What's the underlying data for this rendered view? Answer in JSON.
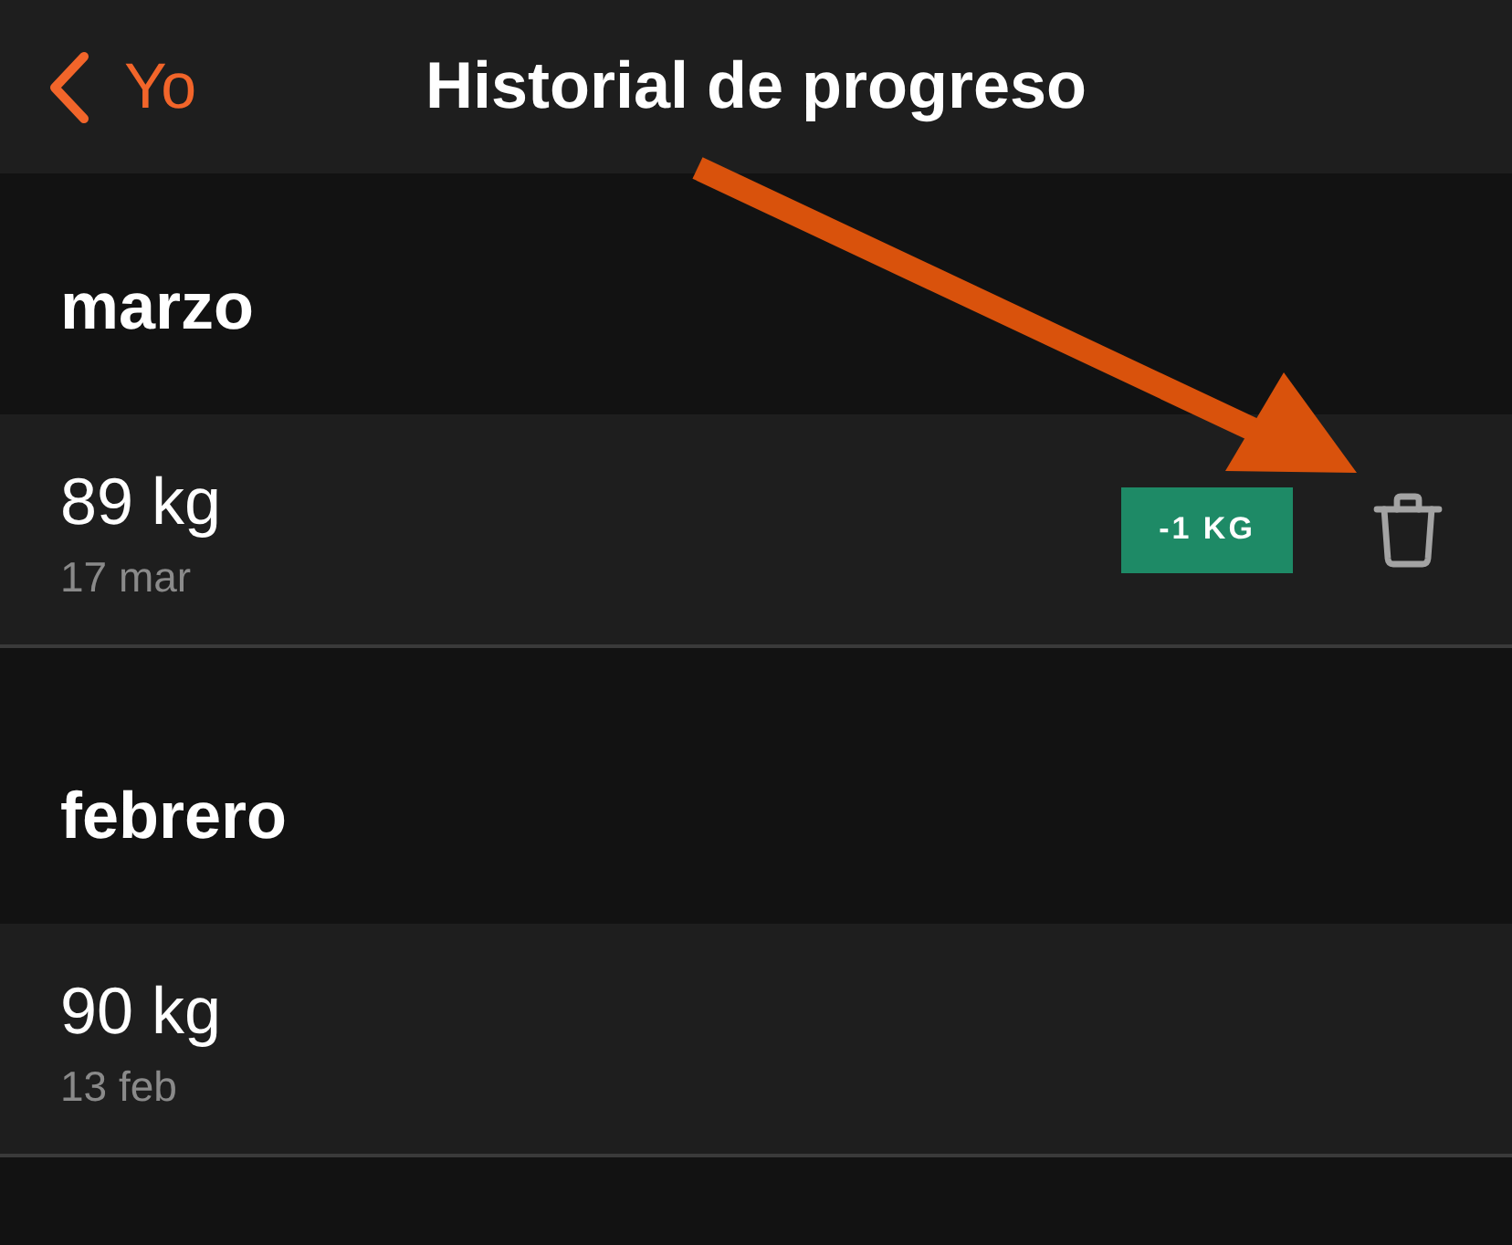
{
  "nav": {
    "back_label": "Yo",
    "title": "Historial de progreso"
  },
  "sections": [
    {
      "title": "marzo",
      "entries": [
        {
          "weight": "89 kg",
          "date": "17 mar",
          "badge": "-1 KG",
          "deletable": true
        }
      ]
    },
    {
      "title": "febrero",
      "entries": [
        {
          "weight": "90 kg",
          "date": "13 feb",
          "deletable": false
        }
      ]
    }
  ]
}
